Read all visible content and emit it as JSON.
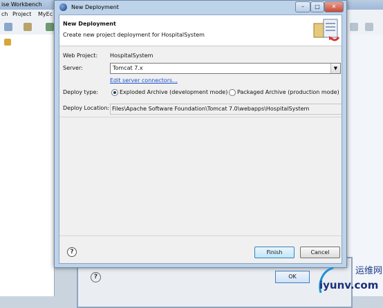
{
  "workbench": {
    "title": "ise Workbench",
    "menu": [
      "ch",
      "Project",
      "MyEc"
    ]
  },
  "dialog": {
    "title": "New Deployment",
    "header_title": "New Deployment",
    "header_desc": "Create new project deployment for HospitalSystem",
    "web_project_label": "Web Project:",
    "web_project_value": "HospitalSystem",
    "server_label": "Server:",
    "server_value": "Tomcat  7.x",
    "edit_connectors_link": "Edit server connectors...",
    "deploy_type_label": "Deploy type:",
    "deploy_options": [
      "Exploded Archive (development mode)",
      "Packaged Archive (production mode)"
    ],
    "deploy_selected": "Exploded Archive (development mode)",
    "deploy_location_label": "Deploy Location:",
    "deploy_location_value": "Files\\Apache Software Foundation\\Tomcat 7.0\\webapps\\HospitalSystem",
    "help_glyph": "?",
    "finish_label": "Finish",
    "cancel_label": "Cancel"
  },
  "background_dialog": {
    "help_glyph": "?",
    "ok_label": "OK"
  },
  "watermark": {
    "line1": "运维网",
    "line2": "iyunv.com"
  }
}
